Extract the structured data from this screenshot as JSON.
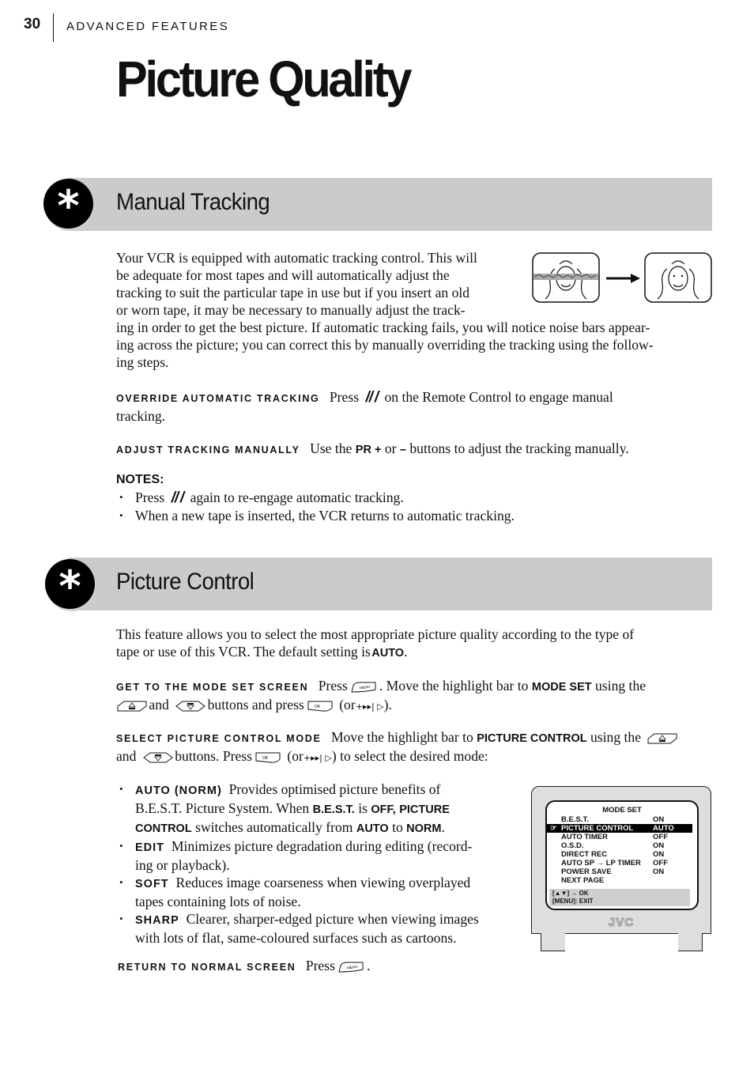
{
  "header": {
    "page_number": "30",
    "section": "ADVANCED FEATURES",
    "title": "Picture Quality"
  },
  "manual_tracking": {
    "heading": "Manual Tracking",
    "badge_icon": "asterisk-icon",
    "intro_lines": [
      "Your VCR is equipped with automatic tracking control. This will",
      "be adequate for most tapes and will automatically adjust the",
      "tracking to suit the particular tape in use but if you insert an old",
      "or worn tape, it may be necessary to manually adjust the track-",
      "ing in order to get the best picture. If automatic tracking fails, you will notice noise bars appear-",
      "ing across the picture; you can correct this by manually overriding the tracking using the follow-",
      "ing steps."
    ],
    "illustration": {
      "before": "tv-noise-bars-illustration",
      "after": "tv-clear-picture-illustration",
      "arrow": "arrow-right-icon"
    },
    "steps": {
      "override": {
        "lead": "OVERRIDE AUTOMATIC TRACKING",
        "pre": "Press",
        "button": "// /",
        "post": "on the Remote Control to engage manual",
        "cont": "tracking."
      },
      "adjust": {
        "lead": "ADJUST TRACKING MANUALLY",
        "pre": "Use the",
        "key1": "PR +",
        "mid": "or",
        "key2": "–",
        "post": "buttons to adjust the tracking manually."
      }
    },
    "notes": {
      "heading": "NOTES:",
      "note1_pre": "Press",
      "note1_button": "// /",
      "note1_post": "again to re-engage automatic tracking.",
      "note2": "When a new tape is inserted, the VCR returns to automatic tracking."
    }
  },
  "picture_control": {
    "heading": "Picture Control",
    "badge_icon": "asterisk-icon",
    "intro_line1": "This feature allows you to select the most appropriate picture quality according to the type of",
    "intro_line2_pre": "tape or use of this VCR. The default setting is",
    "intro_default": "AUTO",
    "intro_end": ".",
    "get_mode_set": {
      "lead": "GET TO THE MODE SET SCREEN",
      "t1": "Press",
      "t2": ". Move the highlight bar to",
      "k1": "MODE SET",
      "t3": "using the",
      "t4": "and",
      "t5": "buttons and press",
      "t6": "(or",
      "t7": ")."
    },
    "select_mode": {
      "lead": "SELECT PICTURE CONTROL MODE",
      "t1": "Move the highlight bar to",
      "k1": "PICTURE CONTROL",
      "t2": "using the",
      "t3": "and",
      "t4": "buttons. Press",
      "t5": "(or",
      "t6": ") to select the desired mode:"
    },
    "modes": [
      {
        "name": "AUTO (NORM)",
        "l1": "Provides optimised picture benefits of",
        "l2_pre": "B.E.S.T. Picture System. When",
        "k_best": "B.E.S.T.",
        "is": "is",
        "k_off": "OFF,",
        "k_pc1": "PICTURE",
        "k_pc2": "CONTROL",
        "l3_mid": "switches automatically from",
        "k_auto": "AUTO",
        "to": "to",
        "k_norm": "NORM",
        "end": "."
      },
      {
        "name": "EDIT",
        "l1": "Minimizes picture degradation during editing (record-",
        "l2": "ing or playback)."
      },
      {
        "name": "SOFT",
        "l1": "Reduces image coarseness when viewing overplayed",
        "l2": "tapes containing lots of noise."
      },
      {
        "name": "SHARP",
        "l1": "Clearer, sharper-edged picture when viewing images",
        "l2": "with lots of flat, same-coloured surfaces such as cartoons."
      }
    ],
    "return": {
      "lead": "RETURN TO NORMAL SCREEN",
      "pre": "Press",
      "end": "."
    },
    "remote_buttons": {
      "menu": "MENU",
      "ok": "OK",
      "up": "up-arrow-button",
      "down": "down-arrow-button",
      "skip": "skip-forward-button"
    },
    "tv_osd": {
      "title": "MODE SET",
      "rows": [
        {
          "label": "B.E.S.T.",
          "value": "ON",
          "highlighted": false
        },
        {
          "label": "PICTURE CONTROL",
          "value": "AUTO",
          "highlighted": true
        },
        {
          "label": "AUTO TIMER",
          "value": "OFF",
          "highlighted": false
        },
        {
          "label": "O.S.D.",
          "value": "ON",
          "highlighted": false
        },
        {
          "label": "DIRECT REC",
          "value": "ON",
          "highlighted": false
        },
        {
          "label": "AUTO SP → LP TIMER",
          "value": "OFF",
          "highlighted": false
        },
        {
          "label": "POWER SAVE",
          "value": "ON",
          "highlighted": false
        },
        {
          "label": "NEXT PAGE",
          "value": "",
          "highlighted": false
        }
      ],
      "footer_line1": "[▲▼] → OK",
      "footer_line2": "[MENU]: EXIT",
      "brand": "JVC"
    }
  }
}
